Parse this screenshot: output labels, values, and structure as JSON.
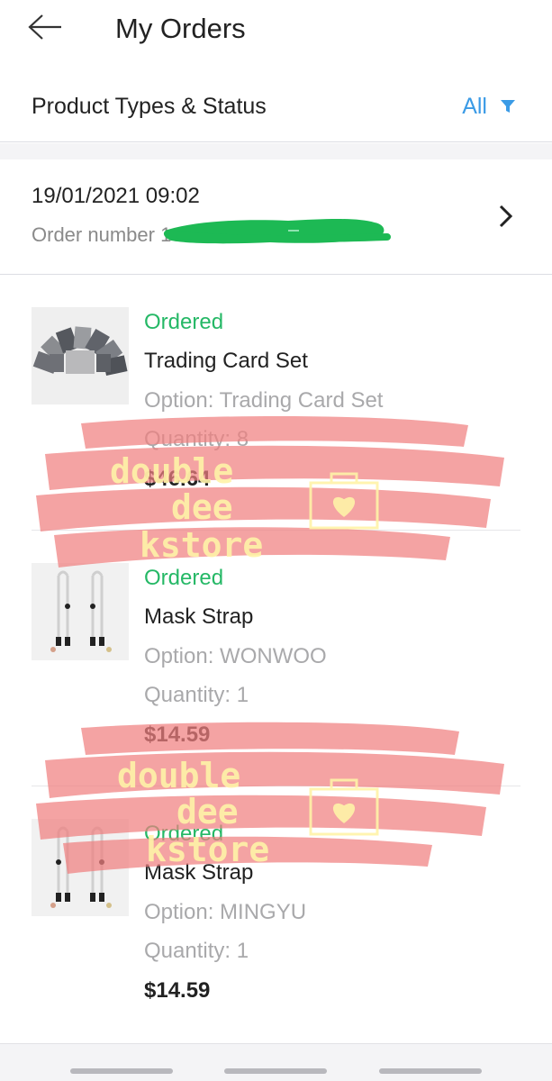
{
  "header": {
    "title": "My Orders",
    "back_icon": "arrow-left-icon"
  },
  "filter": {
    "label": "Product Types & Status",
    "value": "All",
    "icon": "funnel-filter-icon",
    "accent_color": "#3b9be6"
  },
  "order": {
    "datetime": "19/01/2021 09:02",
    "number_label": "Order number",
    "number_partial": "1",
    "chevron_icon": "chevron-right-icon"
  },
  "items": [
    {
      "status": "Ordered",
      "name": "Trading Card Set",
      "option": "Option: Trading Card Set",
      "quantity": "Quantity: 8",
      "price": "$46.64"
    },
    {
      "status": "Ordered",
      "name": "Mask Strap",
      "option": "Option: WONWOO",
      "quantity": "Quantity: 1",
      "price": "$14.59"
    },
    {
      "status": "Ordered",
      "name": "Mask Strap",
      "option": "Option: MINGYU",
      "quantity": "Quantity: 1",
      "price": "$14.59"
    }
  ],
  "watermark": {
    "line1": "double",
    "line2": "dee",
    "line3": "kstore",
    "brush_color": "#f08080",
    "text_color": "#fff3a8"
  },
  "colors": {
    "status_green": "#25b866",
    "muted_text": "#a9a9ab",
    "redaction_green": "#1db954"
  }
}
